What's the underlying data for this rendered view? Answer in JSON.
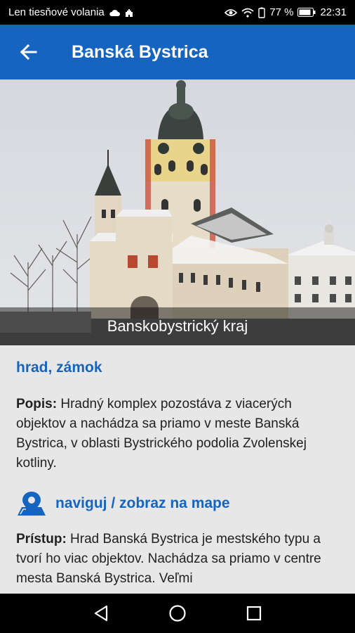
{
  "status_bar": {
    "carrier": "Len tiesňové volania",
    "battery": "77 %",
    "time": "22:31"
  },
  "app_bar": {
    "title": "Banská Bystrica",
    "back_icon": "arrow-left-icon"
  },
  "hero": {
    "caption": "Banskobystrický kraj"
  },
  "detail": {
    "category": "hrad, zámok",
    "description_label": "Popis:",
    "description_text": " Hradný komplex pozostáva z viacerých objektov a nachádza sa priamo v meste Banská Bystrica, v oblasti Bystrického podolia Zvolenskej kotliny.",
    "navigate_label": "naviguj / zobraz na mape",
    "access_label": "Prístup:",
    "access_text": " Hrad Banská Bystrica je mestského typu a tvorí ho viac objektov. Nachádza sa priamo v centre mesta Banská Bystrica. Veľmi"
  },
  "colors": {
    "primary": "#1565c0",
    "background": "#e7e7e7"
  }
}
